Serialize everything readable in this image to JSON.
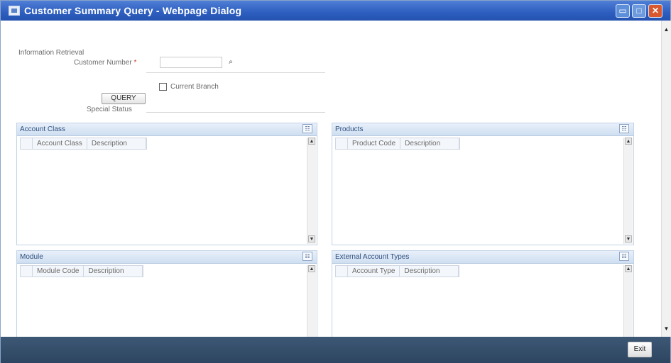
{
  "window": {
    "title": "Customer Summary Query - Webpage Dialog",
    "min_glyph": "▭",
    "max_glyph": "□",
    "close_glyph": "✕"
  },
  "form": {
    "section_label": "Information Retrieval",
    "customer_number_label": "Customer Number",
    "required_marker": "*",
    "customer_number_value": "",
    "lov_glyph": "⌕",
    "current_branch_label": "Current Branch",
    "query_button": "QUERY",
    "special_status_label": "Special Status"
  },
  "panels": {
    "account_class": {
      "title": "Account Class",
      "columns": [
        "Account Class",
        "Description"
      ]
    },
    "products": {
      "title": "Products",
      "columns": [
        "Product Code",
        "Description"
      ]
    },
    "module": {
      "title": "Module",
      "columns": [
        "Module Code",
        "Description"
      ]
    },
    "external_account_types": {
      "title": "External Account Types",
      "columns": [
        "Account Type",
        "Description"
      ]
    }
  },
  "icons": {
    "panel_menu": "☷",
    "scroll_up": "▲",
    "scroll_down": "▼"
  },
  "footer": {
    "exit_button": "Exit"
  }
}
